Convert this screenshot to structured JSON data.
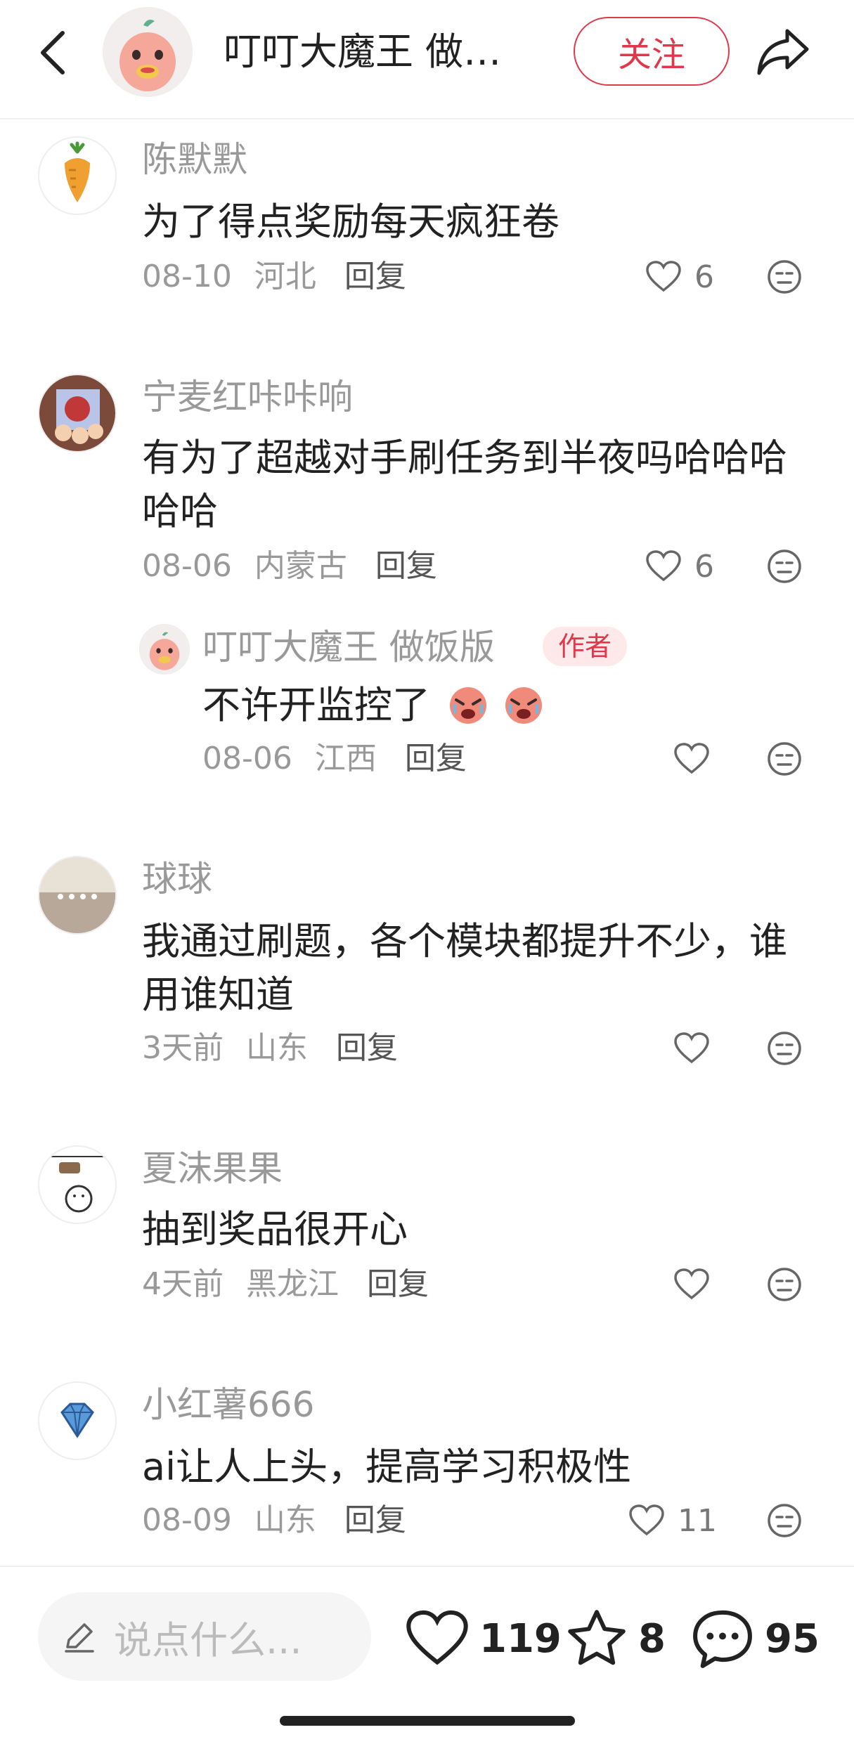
{
  "header": {
    "title": "叮叮大魔王 做…",
    "follow_label": "关注"
  },
  "comments": [
    {
      "username": "陈默默",
      "text": "为了得点奖励每天疯狂卷",
      "date": "08-10",
      "location": "河北",
      "reply_label": "回复",
      "likes": "6"
    },
    {
      "username": "宁麦红咔咔响",
      "text": "有为了超越对手刷任务到半夜吗哈哈哈哈哈",
      "date": "08-06",
      "location": "内蒙古",
      "reply_label": "回复",
      "likes": "6",
      "replies": [
        {
          "username": "叮叮大魔王 做饭版",
          "badge": "作者",
          "text": "不许开监控了",
          "date": "08-06",
          "location": "江西",
          "reply_label": "回复",
          "likes": ""
        }
      ]
    },
    {
      "username": "球球",
      "text": "我通过刷题，各个模块都提升不少，谁用谁知道",
      "date": "3天前",
      "location": "山东",
      "reply_label": "回复",
      "likes": ""
    },
    {
      "username": "夏沫果果",
      "text": "抽到奖品很开心",
      "date": "4天前",
      "location": "黑龙江",
      "reply_label": "回复",
      "likes": ""
    },
    {
      "username": "小红薯666",
      "text": "ai让人上头，提高学习积极性",
      "date": "08-09",
      "location": "山东",
      "reply_label": "回复",
      "likes": "11"
    }
  ],
  "bottom_bar": {
    "input_placeholder": "说点什么...",
    "likes": "119",
    "favorites": "8",
    "comments": "95"
  },
  "colors": {
    "accent": "#e0384b",
    "muted_text": "#999999",
    "badge_bg": "#fde8ea"
  }
}
